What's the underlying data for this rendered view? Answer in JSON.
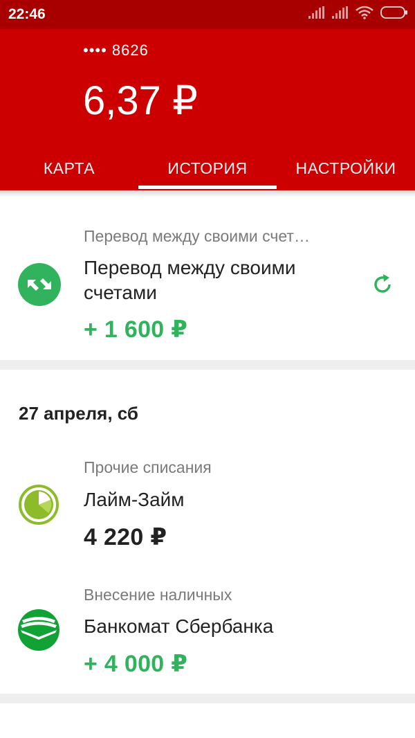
{
  "status_bar": {
    "time": "22:46"
  },
  "header": {
    "card_number": "•••• 8626",
    "balance": "6,37 ₽",
    "tabs": [
      {
        "label": "КАРТА"
      },
      {
        "label": "ИСТОРИЯ",
        "active": true
      },
      {
        "label": "НАСТРОЙКИ"
      }
    ]
  },
  "transactions_top": [
    {
      "category": "Перевод между своими счет…",
      "title": "Перевод между своими счетами",
      "amount": "+ 1 600 ₽",
      "icon": "transfer-arrows-icon",
      "action_icon": "repeat-icon"
    }
  ],
  "groups": [
    {
      "date": "27 апреля, сб",
      "transactions": [
        {
          "category": "Прочие списания",
          "title": "Лайм-Займ",
          "amount": "4 220 ₽",
          "icon": "lime-zaim-logo-icon"
        },
        {
          "category": "Внесение наличных",
          "title": "Банкомат Сбербанка",
          "amount": "+ 4 000 ₽",
          "icon": "sberbank-logo-icon"
        }
      ]
    }
  ],
  "colors": {
    "header_red": "#cc0000",
    "status_red": "#a80000",
    "income_green": "#31b35e",
    "text_dark": "#222222",
    "text_gray": "#7a7a7a"
  }
}
